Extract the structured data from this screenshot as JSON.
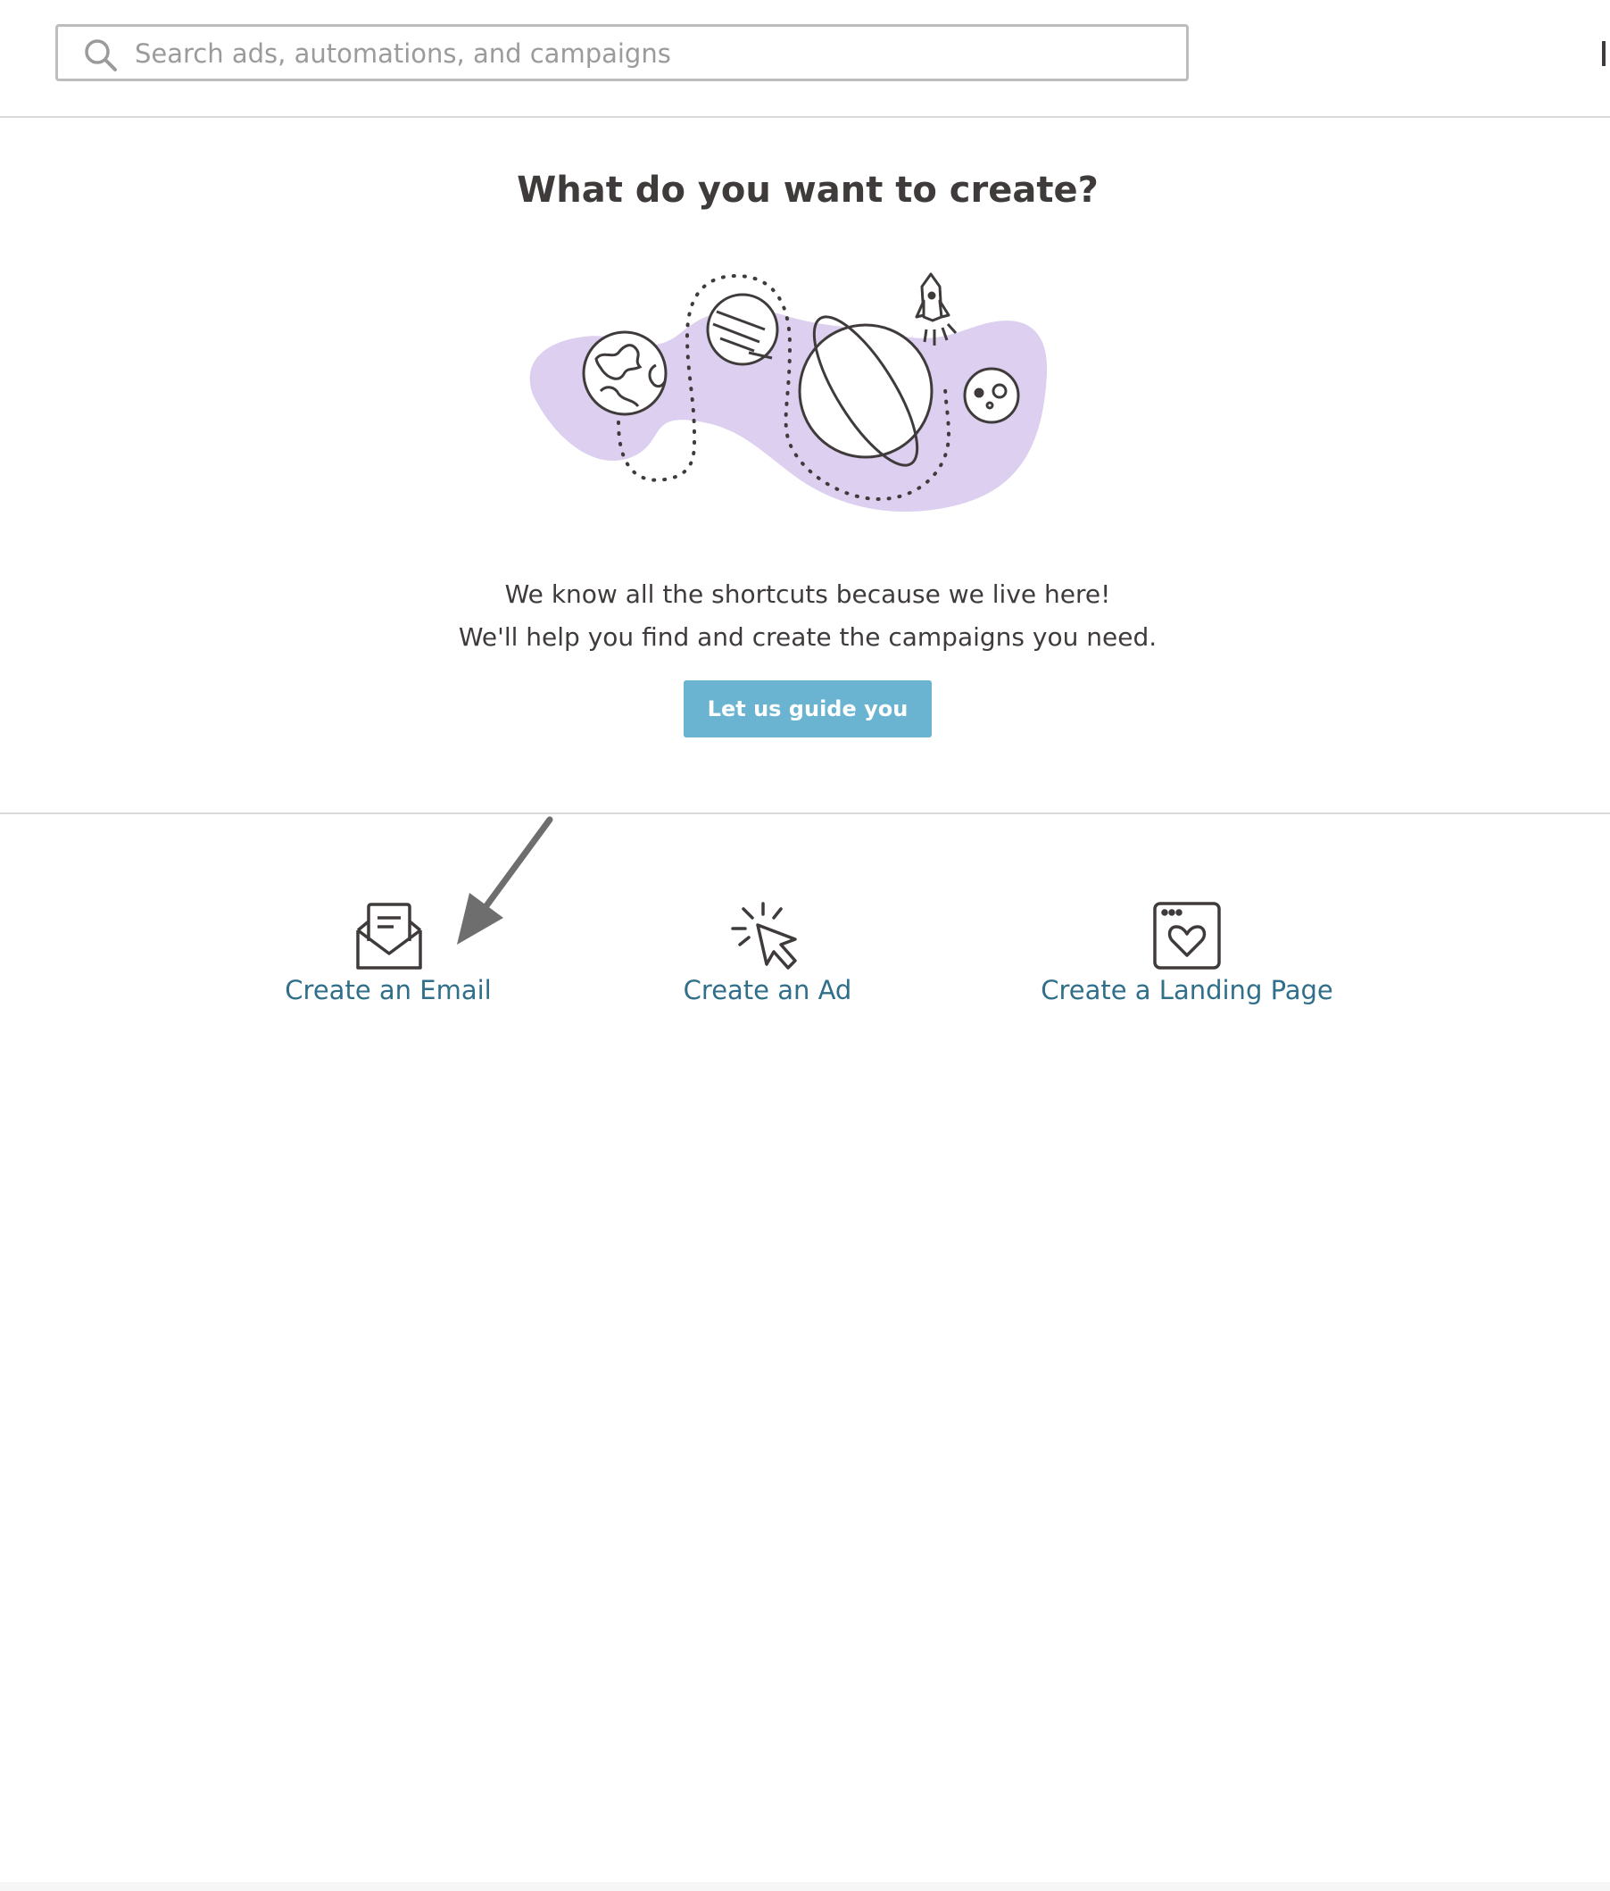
{
  "search": {
    "placeholder": "Search ads, automations, and campaigns",
    "value": "",
    "icon": "search-icon"
  },
  "hero": {
    "title": "What do you want to create?",
    "line1": "We know all the shortcuts because we live here!",
    "line2": "We'll help you find and create the campaigns you need.",
    "button_label": "Let us guide you",
    "button_color": "#6ab4d1",
    "illustration_accent": "#dccff0"
  },
  "create_options": [
    {
      "label": "Create an Email",
      "icon": "envelope-icon"
    },
    {
      "label": "Create an Ad",
      "icon": "cursor-click-icon"
    },
    {
      "label": "Create a Landing Page",
      "icon": "heart-page-icon"
    }
  ],
  "colors": {
    "link": "#2f6f8a",
    "text": "#403b3b",
    "divider": "#d9d9d9",
    "annotation_arrow": "#6e6e6e"
  }
}
